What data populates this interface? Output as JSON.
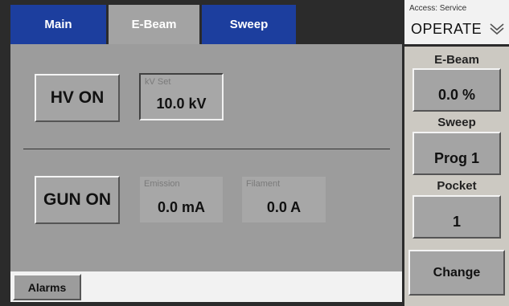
{
  "tabs": [
    {
      "label": "Main"
    },
    {
      "label": "E-Beam"
    },
    {
      "label": "Sweep"
    }
  ],
  "main": {
    "hv_button": "HV ON",
    "kv_set": {
      "label": "kV Set",
      "value": "10.0 kV"
    },
    "gun_button": "GUN ON",
    "emission": {
      "label": "Emission",
      "value": "0.0 mA"
    },
    "filament": {
      "label": "Filament",
      "value": "0.0 A"
    }
  },
  "status_bar": {
    "alarms_label": "Alarms"
  },
  "sidebar": {
    "access_label": "Access: Service",
    "mode": "OPERATE",
    "mode_icon": "chevron-down-icon",
    "ebeam": {
      "label": "E-Beam",
      "value": "0.0 %"
    },
    "sweep": {
      "label": "Sweep",
      "value": "Prog 1"
    },
    "pocket": {
      "label": "Pocket",
      "value": "1"
    },
    "change_label": "Change"
  },
  "colors": {
    "tab_blue": "#1c3e9e",
    "panel_gray": "#9c9c9c",
    "sidebar_beige": "#ccc9c2"
  }
}
